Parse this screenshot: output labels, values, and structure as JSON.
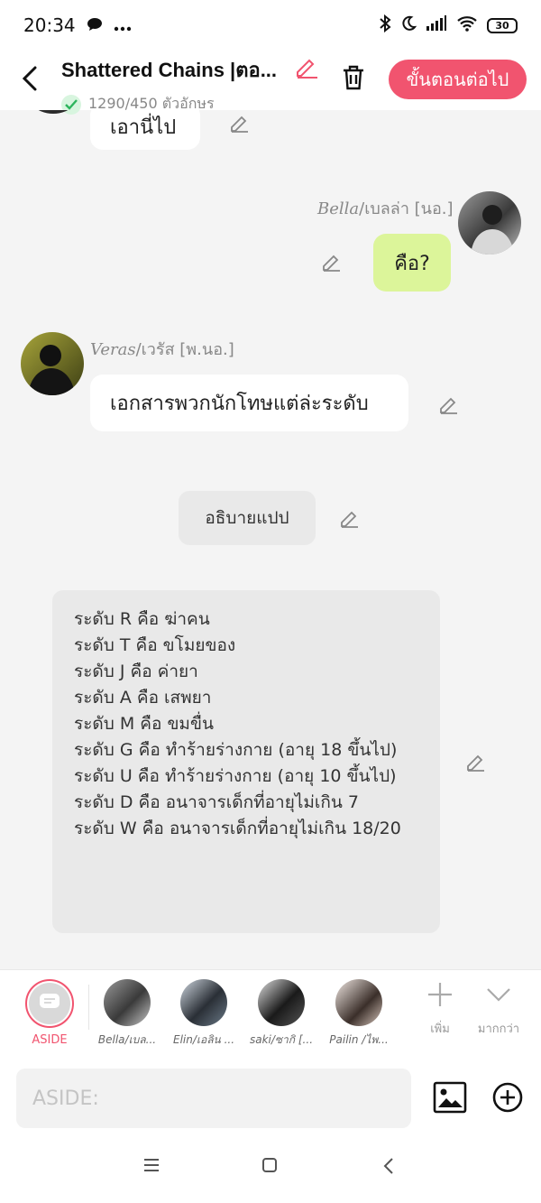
{
  "status": {
    "time": "20:34",
    "battery": "30"
  },
  "header": {
    "title": "Shattered Chains |ตอ...",
    "count": "1290/450 ตัวอักษร",
    "next_label": "ขั้นตอนต่อไป"
  },
  "messages": {
    "m1": {
      "text": "เอานี่ไป"
    },
    "m2": {
      "speaker_en": "Bella",
      "speaker_th": "/เบลล่า [นอ.]",
      "text": "คือ?"
    },
    "m3": {
      "speaker_en": "Veras",
      "speaker_th": "/เวรัส [พ.นอ.]",
      "text": "เอกสารพวกนักโทษแต่ล่ะระดับ"
    },
    "narration": {
      "text": "อธิบายแปป"
    },
    "aside_lines": [
      "ระดับ R คือ ฆ่าคน",
      "ระดับ  T คือ ขโมยของ",
      "ระดับ   J คือ  ค่ายา",
      "ระดับ  A   คือ  เสพยา",
      "ระดับ  M  คือ  ขมขื่น",
      "ระดับ    G   คือ ทำร้ายร่างกาย (อายุ 18 ขึ้นไป)",
      "ระดับ     U   คือ ทำร้ายร่างกาย  (อายุ 10 ขึ้นไป)",
      "ระดับ     D คือ อนาจารเด็กที่อายุไม่เกิน 7",
      "ระดับ    W  คือ อนาจารเด็กที่อายุไม่เกิน 18/20"
    ]
  },
  "characters": [
    {
      "label": "ASIDE"
    },
    {
      "label": "Bella/เบล..."
    },
    {
      "label": "Elin/เอลิน ..."
    },
    {
      "label": "saki/ซากิ [..."
    },
    {
      "label": "Pailin /ไพ..."
    }
  ],
  "actions": {
    "add_label": "เพิ่ม",
    "more_label": "มากกว่า"
  },
  "input": {
    "placeholder": "ASIDE:"
  },
  "colors": {
    "accent": "#f1546f",
    "user_bubble": "#dcf59a",
    "check": "#2db55d"
  }
}
